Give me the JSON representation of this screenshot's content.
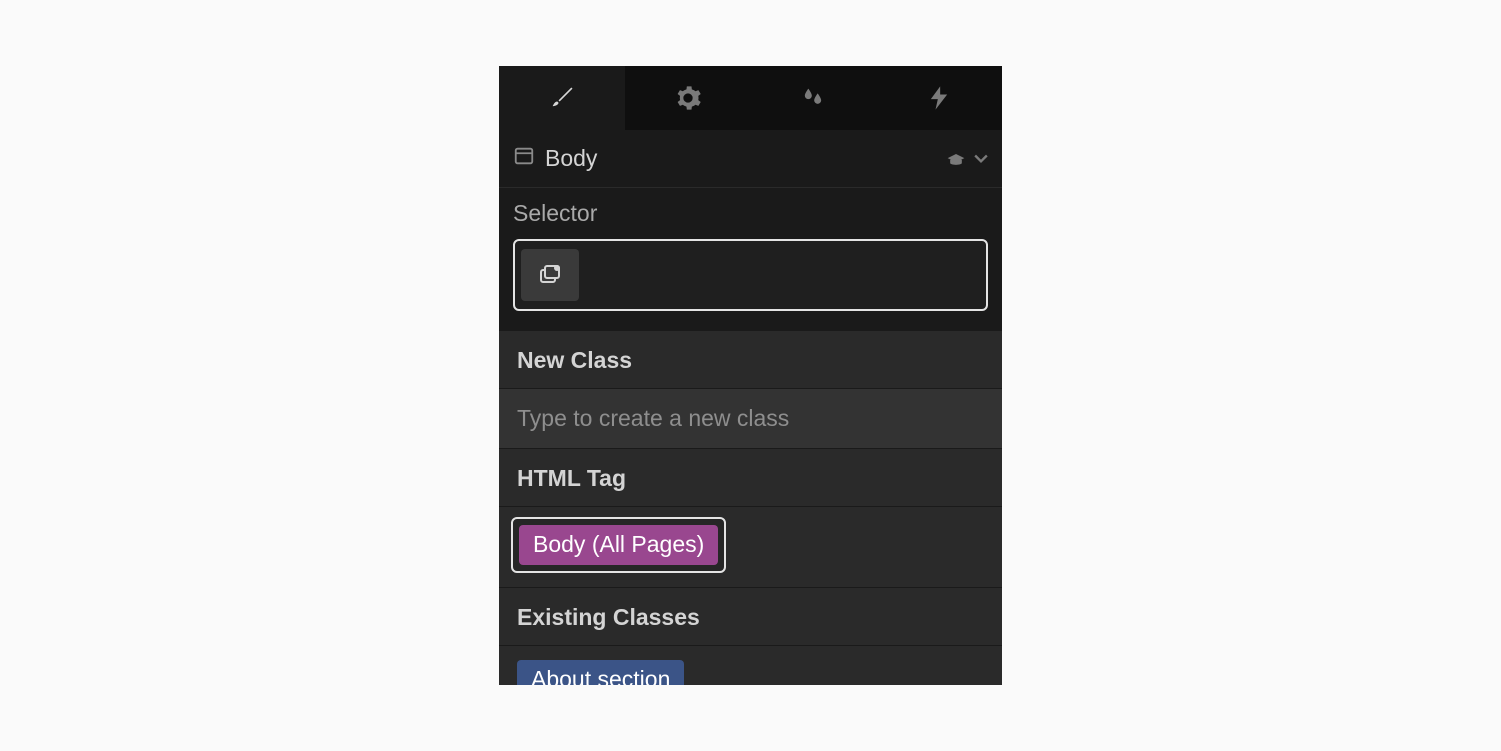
{
  "element_row": {
    "label": "Body"
  },
  "selector": {
    "label": "Selector"
  },
  "dropdown": {
    "new_class_header": "New Class",
    "new_class_hint": "Type to create a new class",
    "html_tag_header": "HTML Tag",
    "html_tag_option": "Body (All Pages)",
    "existing_classes_header": "Existing Classes",
    "existing_class_option": "About section"
  }
}
